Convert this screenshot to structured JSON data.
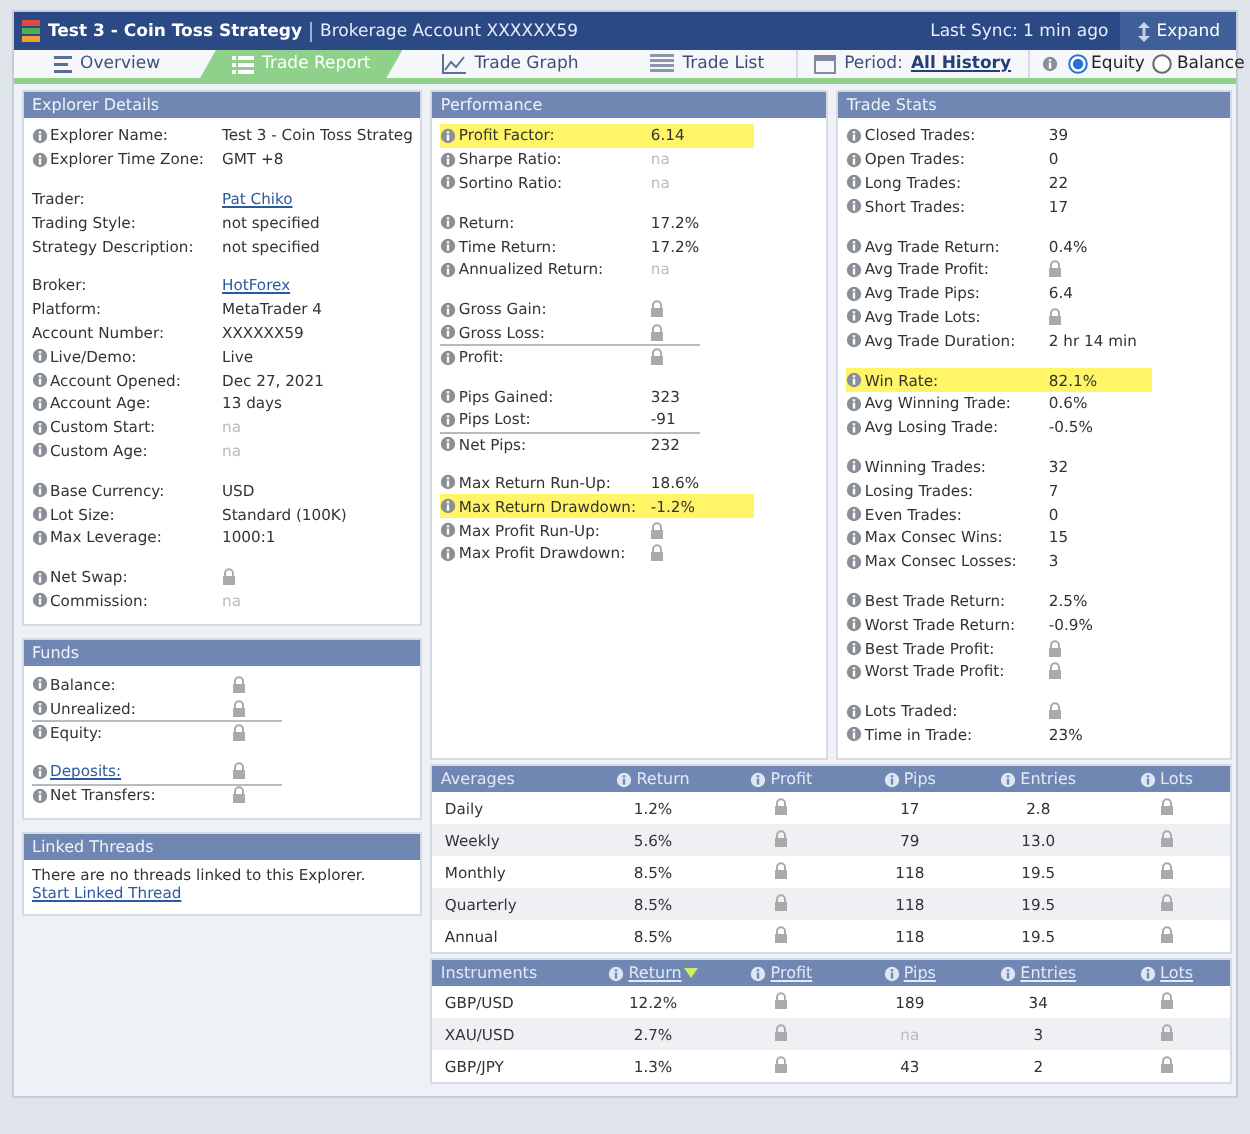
{
  "header": {
    "title": "Test 3 - Coin Toss Strategy",
    "subtitle": "Brokerage Account XXXXXX59",
    "sync": "Last Sync: 1 min ago",
    "expand": "Expand"
  },
  "tabs": [
    {
      "label": "Overview",
      "kind": "overview",
      "selected": false
    },
    {
      "label": "Trade Report",
      "kind": "report",
      "selected": true
    },
    {
      "label": "Trade Graph",
      "kind": "graph",
      "selected": false
    },
    {
      "label": "Trade List",
      "kind": "list",
      "selected": false
    }
  ],
  "period": {
    "label": "Period:",
    "value": "All History"
  },
  "modes": [
    {
      "label": "Equity",
      "selected": true
    },
    {
      "label": "Balance",
      "selected": false
    }
  ],
  "explorer_details": {
    "title": "Explorer Details",
    "groups": [
      [
        {
          "label": "Explorer Name:",
          "value": "Test 3 - Coin Toss Strateg",
          "kind": "text",
          "info": true
        },
        {
          "label": "Explorer Time Zone:",
          "value": "GMT +8",
          "kind": "text",
          "info": true
        }
      ],
      [
        {
          "label": "Trader:",
          "value": "Pat Chiko",
          "kind": "link",
          "info": false
        },
        {
          "label": "Trading Style:",
          "value": "not specified",
          "kind": "text",
          "info": false
        },
        {
          "label": "Strategy Description:",
          "value": "not specified",
          "kind": "text",
          "info": false
        }
      ],
      [
        {
          "label": "Broker:",
          "value": "HotForex",
          "kind": "link",
          "info": false
        },
        {
          "label": "Platform:",
          "value": "MetaTrader 4",
          "kind": "text",
          "info": false
        },
        {
          "label": "Account Number:",
          "value": "XXXXXX59",
          "kind": "text",
          "info": false
        },
        {
          "label": "Live/Demo:",
          "value": "Live",
          "kind": "text",
          "info": true
        },
        {
          "label": "Account Opened:",
          "value": "Dec 27, 2021",
          "kind": "text",
          "info": true
        },
        {
          "label": "Account Age:",
          "value": "13 days",
          "kind": "text",
          "info": true
        },
        {
          "label": "Custom Start:",
          "value": "na",
          "kind": "na",
          "info": true
        },
        {
          "label": "Custom Age:",
          "value": "na",
          "kind": "na",
          "info": true
        }
      ],
      [
        {
          "label": "Base Currency:",
          "value": "USD",
          "kind": "text",
          "info": true
        },
        {
          "label": "Lot Size:",
          "value": "Standard (100K)",
          "kind": "text",
          "info": true
        },
        {
          "label": "Max Leverage:",
          "value": "1000:1",
          "kind": "text",
          "info": true
        }
      ],
      [
        {
          "label": "Net Swap:",
          "kind": "lock",
          "info": true
        },
        {
          "label": "Commission:",
          "value": "na",
          "kind": "na",
          "info": true
        }
      ]
    ]
  },
  "funds": {
    "title": "Funds",
    "groups": [
      [
        {
          "label": "Balance:",
          "kind": "lock",
          "info": true
        },
        {
          "label": "Unrealized:",
          "kind": "lock",
          "info": true
        },
        {
          "label": "Equity:",
          "kind": "lock",
          "info": true,
          "rule_above": true
        }
      ],
      [
        {
          "label": "Deposits:",
          "kind": "lock",
          "info": true,
          "label_link": true
        },
        {
          "label": "Net Transfers:",
          "kind": "lock",
          "info": true,
          "rule_above": true
        }
      ]
    ]
  },
  "linked_threads": {
    "title": "Linked Threads",
    "message": "There are no threads linked to this Explorer.",
    "link": "Start Linked Thread"
  },
  "performance": {
    "title": "Performance",
    "groups": [
      [
        {
          "label": "Profit Factor:",
          "value": "6.14",
          "kind": "text",
          "info": true,
          "highlighted": true
        },
        {
          "label": "Sharpe Ratio:",
          "value": "na",
          "kind": "na",
          "info": true
        },
        {
          "label": "Sortino Ratio:",
          "value": "na",
          "kind": "na",
          "info": true
        }
      ],
      [
        {
          "label": "Return:",
          "value": "17.2%",
          "kind": "text",
          "info": true
        },
        {
          "label": "Time Return:",
          "value": "17.2%",
          "kind": "text",
          "info": true
        },
        {
          "label": "Annualized Return:",
          "value": "na",
          "kind": "na",
          "info": true
        }
      ],
      [
        {
          "label": "Gross Gain:",
          "kind": "lock",
          "info": true
        },
        {
          "label": "Gross Loss:",
          "kind": "lock",
          "info": true
        },
        {
          "label": "Profit:",
          "kind": "lock",
          "info": true,
          "rule_above": true
        }
      ],
      [
        {
          "label": "Pips Gained:",
          "value": "323",
          "kind": "text",
          "info": true
        },
        {
          "label": "Pips Lost:",
          "value": "-91",
          "kind": "text",
          "info": true
        },
        {
          "label": "Net Pips:",
          "value": "232",
          "kind": "text",
          "info": true,
          "rule_above": true
        }
      ],
      [
        {
          "label": "Max Return Run-Up:",
          "value": "18.6%",
          "kind": "text",
          "info": true
        },
        {
          "label": "Max Return Drawdown:",
          "value": "-1.2%",
          "kind": "text",
          "info": true,
          "highlighted": true
        },
        {
          "label": "Max Profit Run-Up:",
          "kind": "lock",
          "info": true
        },
        {
          "label": "Max Profit Drawdown:",
          "kind": "lock",
          "info": true
        }
      ]
    ]
  },
  "trade_stats": {
    "title": "Trade Stats",
    "groups": [
      [
        {
          "label": "Closed Trades:",
          "value": "39",
          "kind": "text",
          "info": true
        },
        {
          "label": "Open Trades:",
          "value": "0",
          "kind": "text",
          "info": true
        },
        {
          "label": "Long Trades:",
          "value": "22",
          "kind": "text",
          "info": true
        },
        {
          "label": "Short Trades:",
          "value": "17",
          "kind": "text",
          "info": true
        }
      ],
      [
        {
          "label": "Avg Trade Return:",
          "value": "0.4%",
          "kind": "text",
          "info": true
        },
        {
          "label": "Avg Trade Profit:",
          "kind": "lock",
          "info": true
        },
        {
          "label": "Avg Trade Pips:",
          "value": "6.4",
          "kind": "text",
          "info": true
        },
        {
          "label": "Avg Trade Lots:",
          "kind": "lock",
          "info": true
        },
        {
          "label": "Avg Trade Duration:",
          "value": "2 hr 14 min",
          "kind": "text",
          "info": true
        }
      ],
      [
        {
          "label": "Win Rate:",
          "value": "82.1%",
          "kind": "text",
          "info": true,
          "highlighted": true
        },
        {
          "label": "Avg Winning Trade:",
          "value": "0.6%",
          "kind": "text",
          "info": true
        },
        {
          "label": "Avg Losing Trade:",
          "value": "-0.5%",
          "kind": "text",
          "info": true
        }
      ],
      [
        {
          "label": "Winning Trades:",
          "value": "32",
          "kind": "text",
          "info": true
        },
        {
          "label": "Losing Trades:",
          "value": "7",
          "kind": "text",
          "info": true
        },
        {
          "label": "Even Trades:",
          "value": "0",
          "kind": "text",
          "info": true
        },
        {
          "label": "Max Consec Wins:",
          "value": "15",
          "kind": "text",
          "info": true
        },
        {
          "label": "Max Consec Losses:",
          "value": "3",
          "kind": "text",
          "info": true
        }
      ],
      [
        {
          "label": "Best Trade Return:",
          "value": "2.5%",
          "kind": "text",
          "info": true
        },
        {
          "label": "Worst Trade Return:",
          "value": "-0.9%",
          "kind": "text",
          "info": true
        },
        {
          "label": "Best Trade Profit:",
          "kind": "lock",
          "info": true
        },
        {
          "label": "Worst Trade Profit:",
          "kind": "lock",
          "info": true
        }
      ],
      [
        {
          "label": "Lots Traded:",
          "kind": "lock",
          "info": true
        },
        {
          "label": "Time in Trade:",
          "value": "23%",
          "kind": "text",
          "info": true
        }
      ]
    ]
  },
  "tables": [
    {
      "title": "Averages",
      "columns": [
        {
          "label": "Return",
          "link": false,
          "sorted": false
        },
        {
          "label": "Profit",
          "link": false,
          "sorted": false
        },
        {
          "label": "Pips",
          "link": false,
          "sorted": false
        },
        {
          "label": "Entries",
          "link": false,
          "sorted": false
        },
        {
          "label": "Lots",
          "link": false,
          "sorted": false
        }
      ],
      "rows": [
        {
          "label": "Daily",
          "cells": [
            {
              "kind": "text",
              "value": "1.2%"
            },
            {
              "kind": "lock"
            },
            {
              "kind": "text",
              "value": "17"
            },
            {
              "kind": "text",
              "value": "2.8"
            },
            {
              "kind": "lock"
            }
          ]
        },
        {
          "label": "Weekly",
          "cells": [
            {
              "kind": "text",
              "value": "5.6%"
            },
            {
              "kind": "lock"
            },
            {
              "kind": "text",
              "value": "79"
            },
            {
              "kind": "text",
              "value": "13.0"
            },
            {
              "kind": "lock"
            }
          ]
        },
        {
          "label": "Monthly",
          "cells": [
            {
              "kind": "text",
              "value": "8.5%"
            },
            {
              "kind": "lock"
            },
            {
              "kind": "text",
              "value": "118"
            },
            {
              "kind": "text",
              "value": "19.5"
            },
            {
              "kind": "lock"
            }
          ]
        },
        {
          "label": "Quarterly",
          "cells": [
            {
              "kind": "text",
              "value": "8.5%"
            },
            {
              "kind": "lock"
            },
            {
              "kind": "text",
              "value": "118"
            },
            {
              "kind": "text",
              "value": "19.5"
            },
            {
              "kind": "lock"
            }
          ]
        },
        {
          "label": "Annual",
          "cells": [
            {
              "kind": "text",
              "value": "8.5%"
            },
            {
              "kind": "lock"
            },
            {
              "kind": "text",
              "value": "118"
            },
            {
              "kind": "text",
              "value": "19.5"
            },
            {
              "kind": "lock"
            }
          ]
        }
      ]
    },
    {
      "title": "Instruments",
      "columns": [
        {
          "label": "Return",
          "link": true,
          "sorted": true
        },
        {
          "label": "Profit",
          "link": true,
          "sorted": false
        },
        {
          "label": "Pips",
          "link": true,
          "sorted": false
        },
        {
          "label": "Entries",
          "link": true,
          "sorted": false
        },
        {
          "label": "Lots",
          "link": true,
          "sorted": false
        }
      ],
      "rows": [
        {
          "label": "GBP/USD",
          "cells": [
            {
              "kind": "text",
              "value": "12.2%"
            },
            {
              "kind": "lock"
            },
            {
              "kind": "text",
              "value": "189"
            },
            {
              "kind": "text",
              "value": "34"
            },
            {
              "kind": "lock"
            }
          ]
        },
        {
          "label": "XAU/USD",
          "cells": [
            {
              "kind": "text",
              "value": "2.7%"
            },
            {
              "kind": "lock"
            },
            {
              "kind": "na",
              "value": "na"
            },
            {
              "kind": "text",
              "value": "3"
            },
            {
              "kind": "lock"
            }
          ]
        },
        {
          "label": "GBP/JPY",
          "cells": [
            {
              "kind": "text",
              "value": "1.3%"
            },
            {
              "kind": "lock"
            },
            {
              "kind": "text",
              "value": "43"
            },
            {
              "kind": "text",
              "value": "2"
            },
            {
              "kind": "lock"
            }
          ]
        }
      ]
    }
  ]
}
